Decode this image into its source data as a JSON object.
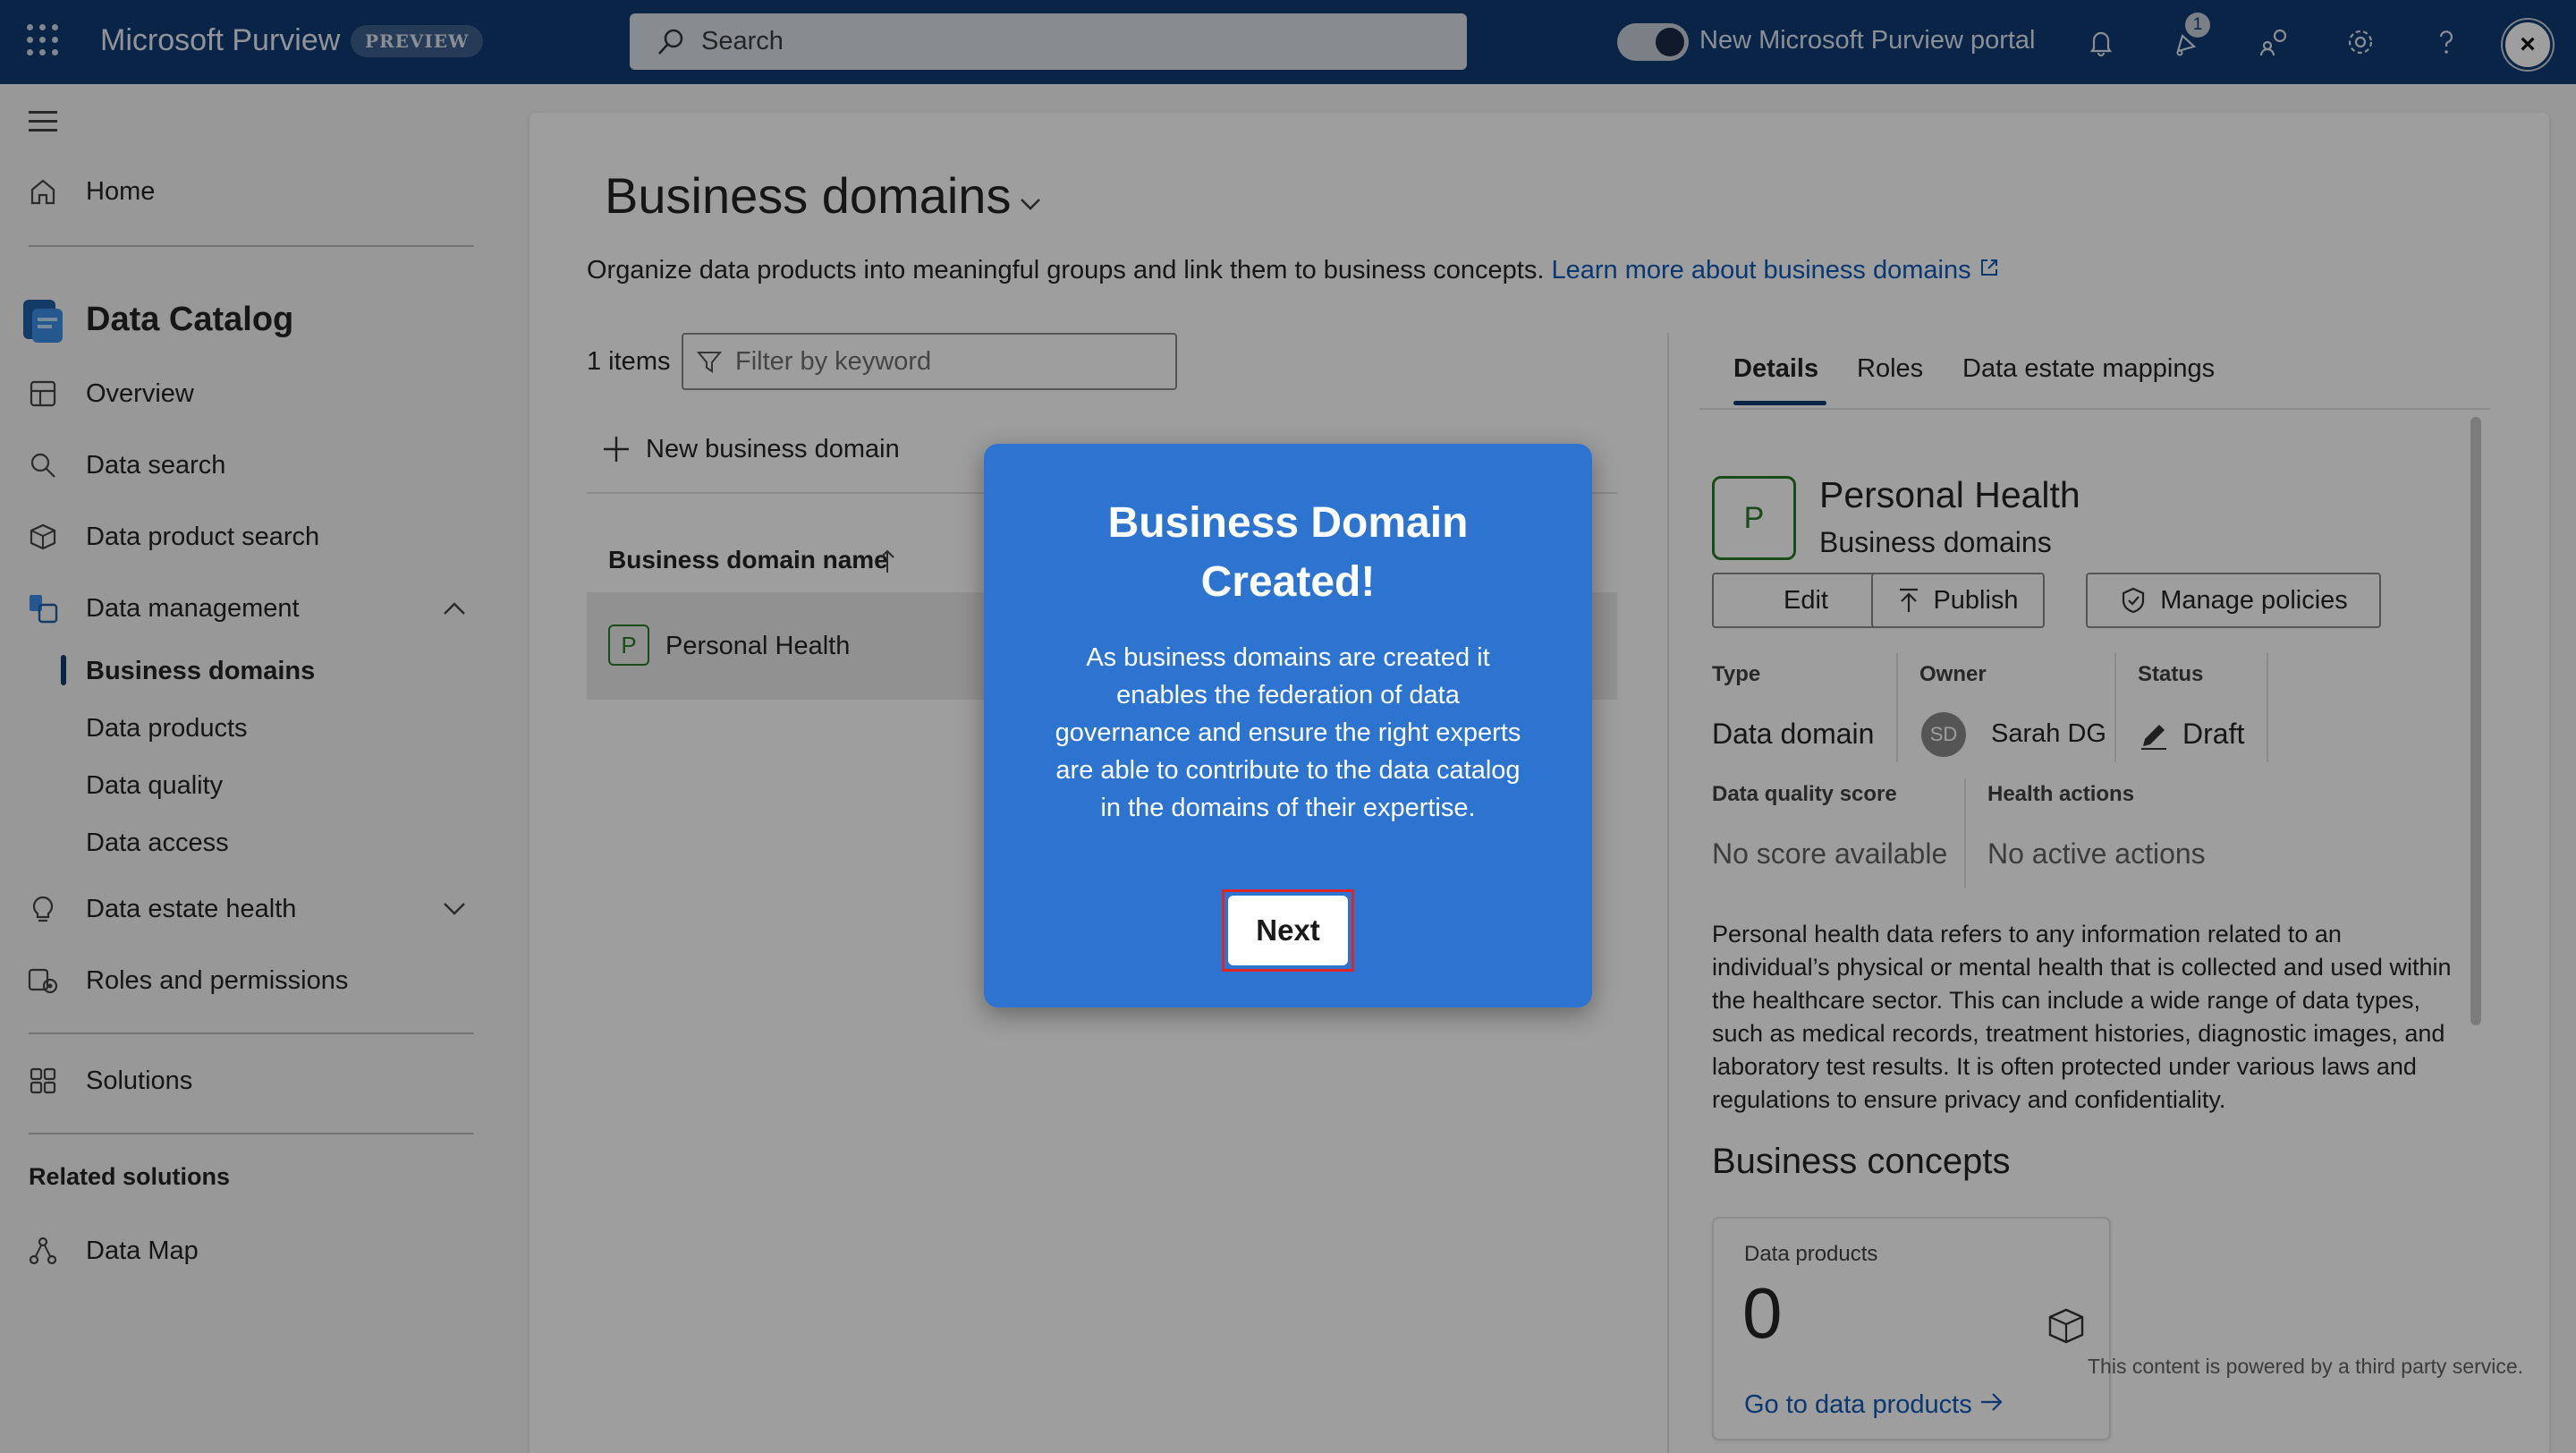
{
  "topbar": {
    "app_title": "Microsoft Purview",
    "badge": "PREVIEW",
    "search_placeholder": "Search",
    "toggle_label": "New Microsoft Purview portal",
    "notification_count": "1",
    "close_glyph": "×",
    "icons": [
      "waffle-icon",
      "search-icon",
      "bell-icon",
      "notification-icon",
      "people-icon",
      "gear-icon",
      "help-icon",
      "close-icon"
    ],
    "colors": {
      "bar": "#0f3a72"
    }
  },
  "sidebar": {
    "home": "Home",
    "data_catalog": "Data Catalog",
    "overview": "Overview",
    "data_search": "Data search",
    "data_product_search": "Data product search",
    "data_management": "Data management",
    "sub_items": [
      "Business domains",
      "Data products",
      "Data quality",
      "Data access"
    ],
    "data_estate_health": "Data estate health",
    "roles_permissions": "Roles and permissions",
    "solutions": "Solutions",
    "related_title": "Related solutions",
    "data_map": "Data Map"
  },
  "main": {
    "title": "Business domains",
    "description": "Organize data products into meaningful groups and link them to business concepts. ",
    "learn_more": "Learn more about business domains",
    "items_count": "1 items",
    "filter_placeholder": "Filter by keyword",
    "new_domain": "New business domain",
    "column_header": "Business domain name",
    "rows": [
      {
        "badge": "P",
        "name": "Personal Health"
      }
    ]
  },
  "details": {
    "tabs": [
      "Details",
      "Roles",
      "Data estate mappings"
    ],
    "badge": "P",
    "name": "Personal Health",
    "subtitle": "Business domains",
    "buttons": {
      "edit": "Edit",
      "publish": "Publish",
      "manage_policies": "Manage policies"
    },
    "type_label": "Type",
    "type_value": "Data domain",
    "owner_label": "Owner",
    "owner_initials": "SD",
    "owner_value": "Sarah DG",
    "status_label": "Status",
    "status_value": "Draft",
    "quality_label": "Data quality score",
    "quality_value": "No score available",
    "health_label": "Health actions",
    "health_value": "No active actions",
    "description": "Personal health data refers to any information related to an individual’s physical or mental health that is collected and used within the healthcare sector. This can include a wide range of data types, such as medical records, treatment histories, diagnostic images, and laboratory test results. It is often protected under various laws and regulations to ensure privacy and confidentiality.",
    "concepts_title": "Business concepts",
    "card": {
      "title": "Data products",
      "count": "0",
      "link": "Go to data products"
    }
  },
  "footer_note": "This content is powered by a third party service.",
  "modal": {
    "title": "Business Domain Created!",
    "body": "As business domains are created it enables the federation of data governance and ensure the right experts are able to contribute to the data catalog in the domains of their expertise.",
    "next": "Next",
    "colors": {
      "background": "#2c74cf",
      "highlight": "#e0242c"
    }
  }
}
